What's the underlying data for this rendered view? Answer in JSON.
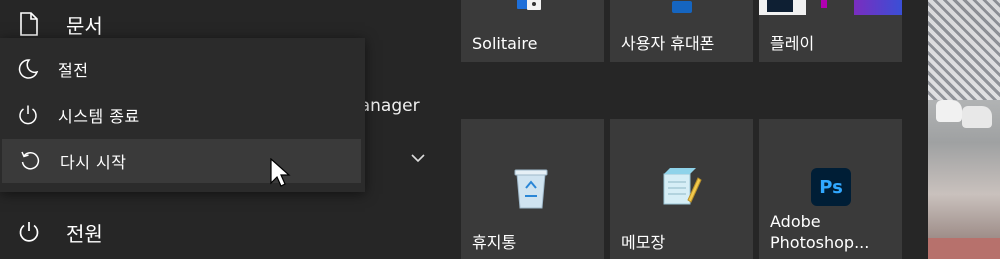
{
  "nav": {
    "documents_label": "문서",
    "power_label": "전원"
  },
  "power_menu": {
    "items": [
      {
        "label": "절전",
        "icon": "moon-icon"
      },
      {
        "label": "시스템 종료",
        "icon": "power-icon"
      },
      {
        "label": "다시 시작",
        "icon": "restart-icon"
      }
    ]
  },
  "app_list": {
    "partial_label": "lanager"
  },
  "tiles": {
    "solitaire": "Solitaire",
    "phone": "사용자 휴대폰",
    "play": "플레이",
    "recycle_bin": "휴지통",
    "notepad": "메모장",
    "photoshop_line1": "Adobe",
    "photoshop_line2": "Photoshop...",
    "ps_logo": "Ps"
  },
  "colors": {
    "start_bg": "#262626",
    "flyout_bg": "#2b2b2b",
    "hover_bg": "#3a3a3a",
    "tile_bg": "#3a3a3a",
    "ps_blue": "#31a8ff"
  }
}
